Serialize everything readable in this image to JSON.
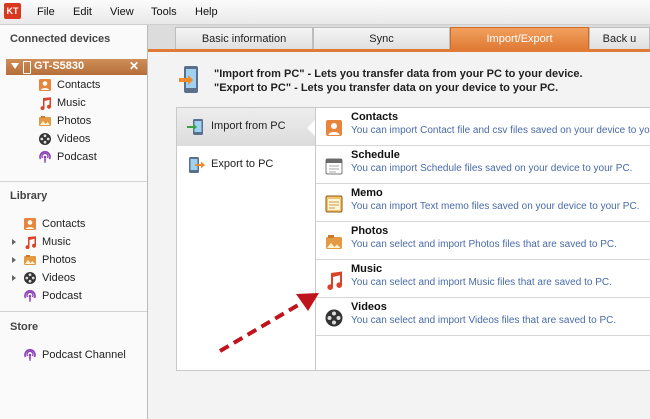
{
  "app": {
    "logo_text": "KT"
  },
  "menu": [
    "File",
    "Edit",
    "View",
    "Tools",
    "Help"
  ],
  "sidebar": {
    "connected_title": "Connected devices",
    "device": {
      "name": "GT-S5830",
      "close": "✕"
    },
    "device_items": [
      "Contacts",
      "Music",
      "Photos",
      "Videos",
      "Podcast"
    ],
    "library_title": "Library",
    "library_items": [
      "Contacts",
      "Music",
      "Photos",
      "Videos",
      "Podcast"
    ],
    "store_title": "Store",
    "store_items": [
      "Podcast Channel"
    ]
  },
  "tabs": [
    "Basic information",
    "Sync",
    "Import/Export",
    "Back u"
  ],
  "active_tab": "Import/Export",
  "info": {
    "line1": "\"Import from PC\" - Lets you transfer data from your PC to your device.",
    "line2": "\"Export to PC\" - Lets you transfer data on your device to your PC."
  },
  "left_options": [
    "Import from PC",
    "Export to PC"
  ],
  "rows": [
    {
      "title": "Contacts",
      "desc": "You can import Contact file and csv files saved on your device to your PC.",
      "icon": "contacts-icon"
    },
    {
      "title": "Schedule",
      "desc": "You can import Schedule files saved on your device to your PC.",
      "icon": "schedule-icon"
    },
    {
      "title": "Memo",
      "desc": "You can import Text memo files saved on your device to your PC.",
      "icon": "memo-icon"
    },
    {
      "title": "Photos",
      "desc": "You can select and import Photos files that are saved to PC.",
      "icon": "photos-icon"
    },
    {
      "title": "Music",
      "desc": "You can select and import Music files that are saved to PC.",
      "icon": "music-icon"
    },
    {
      "title": "Videos",
      "desc": "You can select and import Videos files that are saved to PC.",
      "icon": "videos-icon"
    }
  ],
  "colors": {
    "accent": "#e07b35",
    "device_bg": "#b56e3a",
    "annotation": "#c0141c",
    "desc_text": "#4a6aa8"
  }
}
